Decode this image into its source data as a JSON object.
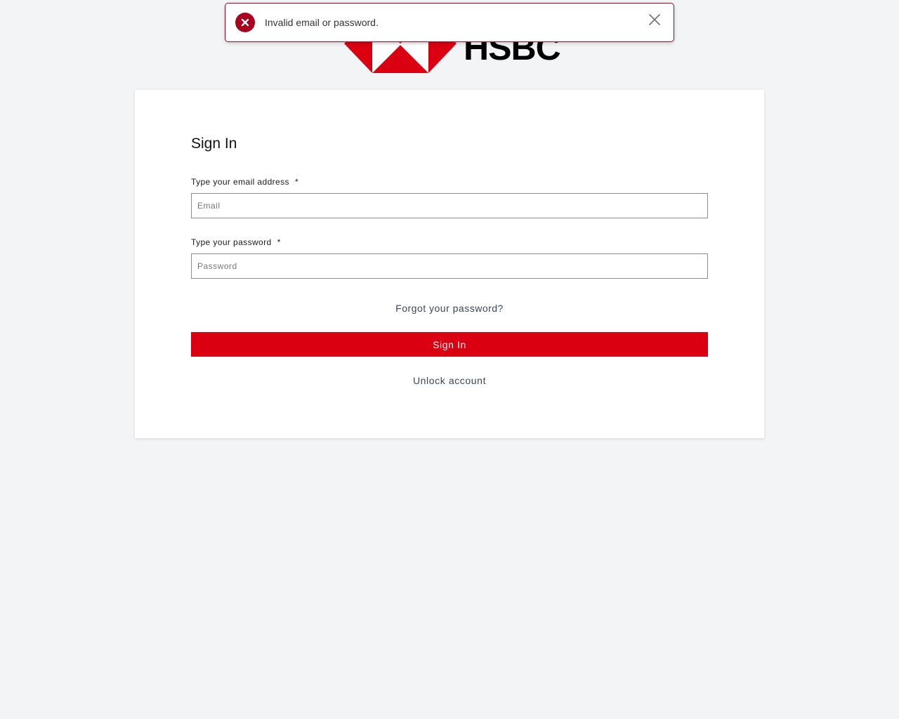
{
  "brand": {
    "name": "HSBC",
    "accent_color": "#db0011",
    "logo_icon": "hsbc-hexagon-logo"
  },
  "toast": {
    "message": "Invalid email or password.",
    "icon": "error-x-circle-icon",
    "close_icon": "close-x-icon",
    "color": "#a8001e"
  },
  "form": {
    "title": "Sign In",
    "email": {
      "label": "Type your email address",
      "required_marker": "*",
      "placeholder": "Email",
      "value": ""
    },
    "password": {
      "label": "Type your password",
      "required_marker": "*",
      "placeholder": "Password",
      "value": ""
    },
    "forgot_link": "Forgot your password?",
    "submit_label": "Sign In",
    "unlock_link": "Unlock account"
  }
}
